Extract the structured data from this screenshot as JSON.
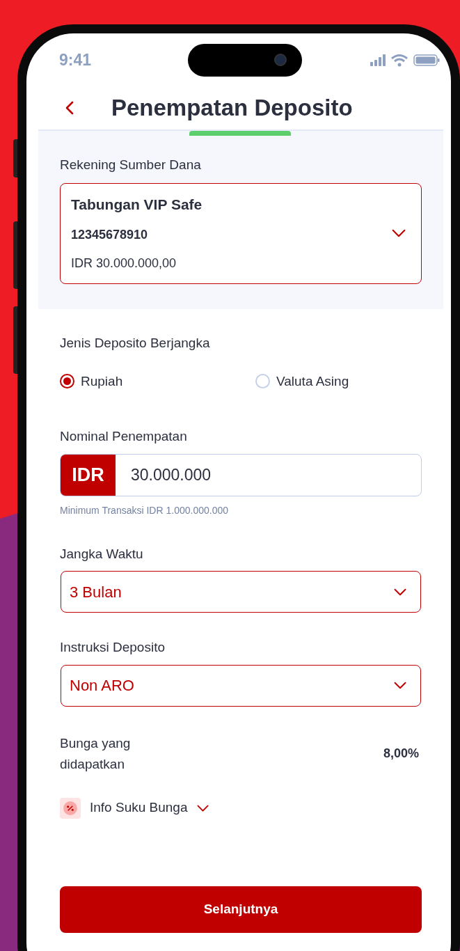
{
  "status_bar": {
    "time": "9:41"
  },
  "header": {
    "title": "Penempatan Deposito"
  },
  "source_account": {
    "label": "Rekening Sumber Dana",
    "name": "Tabungan VIP Safe",
    "number": "12345678910",
    "balance": "IDR 30.000.000,00"
  },
  "deposit_type": {
    "label": "Jenis Deposito Berjangka",
    "options": [
      {
        "label": "Rupiah",
        "selected": true
      },
      {
        "label": "Valuta Asing",
        "selected": false
      }
    ]
  },
  "amount": {
    "label": "Nominal Penempatan",
    "currency": "IDR",
    "value": "30.000.000",
    "hint": "Minimum Transaksi IDR 1.000.000.000"
  },
  "term": {
    "label": "Jangka Waktu",
    "value": "3 Bulan"
  },
  "instruction": {
    "label": "Instruksi Deposito",
    "value": "Non ARO"
  },
  "interest": {
    "label": "Bunga yang didapatkan",
    "value": "8,00%"
  },
  "rate_info": {
    "label": "Info Suku Bunga",
    "expanded": false
  },
  "next_button": "Selanjutnya"
}
